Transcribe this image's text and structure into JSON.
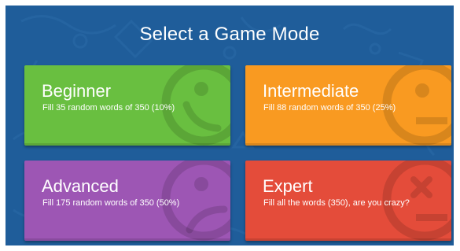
{
  "screen": {
    "title": "Select a Game Mode",
    "background_color": "#1f5d9a"
  },
  "modes": [
    {
      "name": "Beginner",
      "description": "Fill 35 random words of 350 (10%)",
      "color": "#69bf40",
      "icon": "smiley-happy-icon"
    },
    {
      "name": "Intermediate",
      "description": "Fill 88 random words of 350 (25%)",
      "color": "#f99a21",
      "icon": "smiley-neutral-icon"
    },
    {
      "name": "Advanced",
      "description": "Fill 175 random words of 350 (50%)",
      "color": "#9d56b4",
      "icon": "smiley-sad-icon"
    },
    {
      "name": "Expert",
      "description": "Fill all the words (350), are you crazy?",
      "color": "#e44c3a",
      "icon": "smiley-dead-icon"
    }
  ]
}
